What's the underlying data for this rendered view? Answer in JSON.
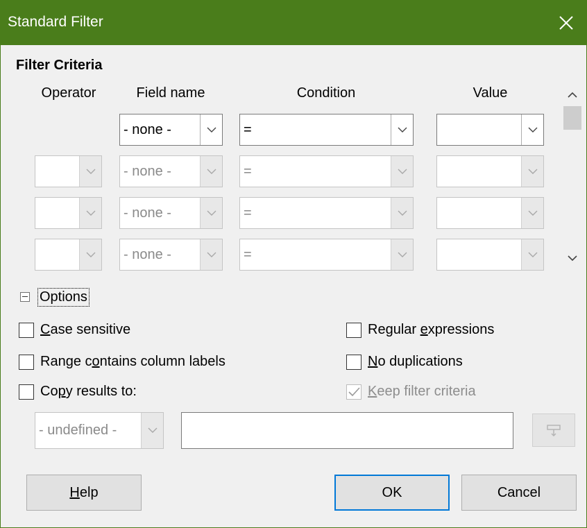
{
  "window": {
    "title": "Standard Filter"
  },
  "filter_criteria": {
    "section_title": "Filter Criteria",
    "columns": {
      "operator": "Operator",
      "field_name": "Field name",
      "condition": "Condition",
      "value": "Value"
    },
    "rows": [
      {
        "operator": "",
        "field_name": "- none -",
        "condition": "=",
        "value": "",
        "enabled": true
      },
      {
        "operator": "",
        "field_name": "- none -",
        "condition": "=",
        "value": "",
        "enabled": false
      },
      {
        "operator": "",
        "field_name": "- none -",
        "condition": "=",
        "value": "",
        "enabled": false
      },
      {
        "operator": "",
        "field_name": "- none -",
        "condition": "=",
        "value": "",
        "enabled": false
      }
    ]
  },
  "options": {
    "label": "Options",
    "case_sensitive": {
      "pre": "",
      "key": "C",
      "post": "ase sensitive",
      "checked": false
    },
    "range_labels": {
      "pre": "Range c",
      "key": "o",
      "post": "ntains column labels",
      "checked": false
    },
    "copy_results": {
      "pre": "Co",
      "key": "p",
      "post": "y results to:",
      "checked": false
    },
    "regular_expressions": {
      "pre": "Regular ",
      "key": "e",
      "post": "xpressions",
      "checked": false
    },
    "no_duplications": {
      "pre": "",
      "key": "N",
      "post": "o duplications",
      "checked": false
    },
    "keep_filter_criteria": {
      "pre": "",
      "key": "K",
      "post": "eep filter criteria",
      "checked": true,
      "enabled": false
    },
    "copy_target_select": "- undefined -",
    "copy_target_input": ""
  },
  "buttons": {
    "help": {
      "key": "H",
      "rest": "elp"
    },
    "ok": "OK",
    "cancel": "Cancel"
  },
  "icons": {
    "close": "close-icon",
    "dropdown": "chevron-down-icon",
    "scroll_up": "chevron-up-icon",
    "scroll_down": "chevron-down-icon",
    "shrink": "shrink-icon",
    "check": "checkmark-icon"
  },
  "colors": {
    "titlebar": "#4a7d1b",
    "default_button_border": "#0078d7"
  }
}
